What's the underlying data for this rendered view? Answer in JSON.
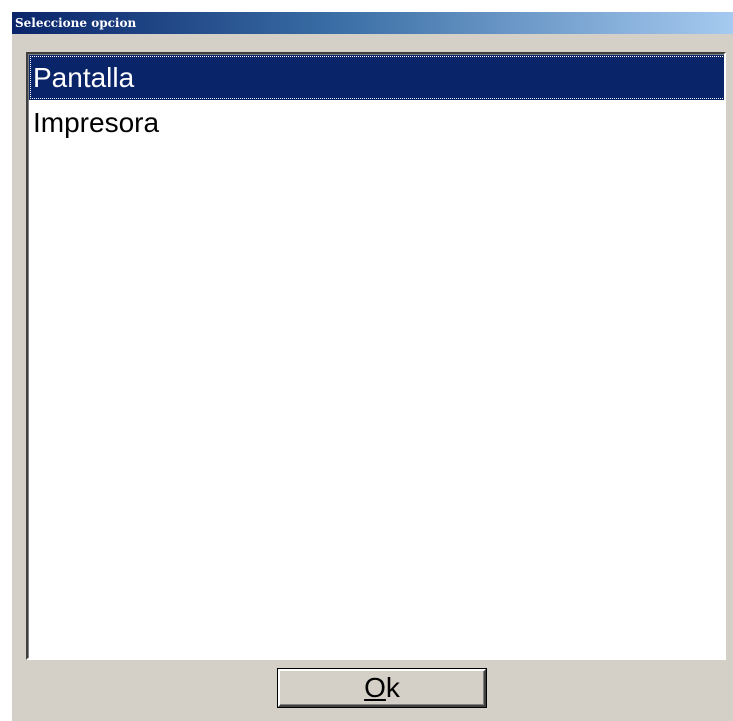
{
  "window": {
    "title": "Seleccione opcion"
  },
  "listbox": {
    "items": [
      {
        "label": "Pantalla",
        "selected": true
      },
      {
        "label": "Impresora",
        "selected": false
      }
    ]
  },
  "buttons": {
    "ok": {
      "mnemonic": "O",
      "rest": "k"
    }
  },
  "colors": {
    "titlebar_start": "#0a246a",
    "titlebar_end": "#a6caf0",
    "selection": "#0a246a",
    "face": "#d4d0c8"
  }
}
